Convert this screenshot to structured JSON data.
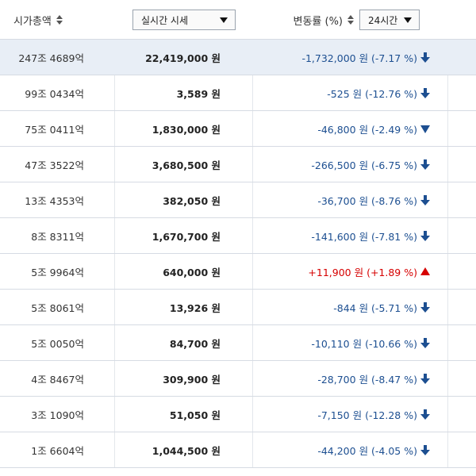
{
  "header": {
    "market_cap_label": "시가총액",
    "realtime_select": "실시간 시세",
    "change_label": "변동률 (%)",
    "period_select": "24시간"
  },
  "colors": {
    "down": "#1d4f91",
    "up": "#d60000",
    "highlight_row": "#e8eef6"
  },
  "rows": [
    {
      "market_cap": "247조 4689억",
      "price": "22,419,000 원",
      "change": "-1,732,000 원 (-7.17 %)",
      "direction": "down",
      "arrow": "arrow-down-bold",
      "highlight": true
    },
    {
      "market_cap": "99조 0434억",
      "price": "3,589 원",
      "change": "-525 원 (-12.76 %)",
      "direction": "down",
      "arrow": "arrow-down-bold",
      "highlight": false
    },
    {
      "market_cap": "75조 0411억",
      "price": "1,830,000 원",
      "change": "-46,800 원 (-2.49 %)",
      "direction": "down",
      "arrow": "triangle-down",
      "highlight": false
    },
    {
      "market_cap": "47조 3522억",
      "price": "3,680,500 원",
      "change": "-266,500 원 (-6.75 %)",
      "direction": "down",
      "arrow": "arrow-down-bold",
      "highlight": false
    },
    {
      "market_cap": "13조 4353억",
      "price": "382,050 원",
      "change": "-36,700 원 (-8.76 %)",
      "direction": "down",
      "arrow": "arrow-down-bold",
      "highlight": false
    },
    {
      "market_cap": "8조 8311억",
      "price": "1,670,700 원",
      "change": "-141,600 원 (-7.81 %)",
      "direction": "down",
      "arrow": "arrow-down-bold",
      "highlight": false
    },
    {
      "market_cap": "5조 9964억",
      "price": "640,000 원",
      "change": "+11,900 원 (+1.89 %)",
      "direction": "up",
      "arrow": "triangle-up",
      "highlight": false
    },
    {
      "market_cap": "5조 8061억",
      "price": "13,926 원",
      "change": "-844 원 (-5.71 %)",
      "direction": "down",
      "arrow": "arrow-down-bold",
      "highlight": false
    },
    {
      "market_cap": "5조 0050억",
      "price": "84,700 원",
      "change": "-10,110 원 (-10.66 %)",
      "direction": "down",
      "arrow": "arrow-down-bold",
      "highlight": false
    },
    {
      "market_cap": "4조 8467억",
      "price": "309,900 원",
      "change": "-28,700 원 (-8.47 %)",
      "direction": "down",
      "arrow": "arrow-down-bold",
      "highlight": false
    },
    {
      "market_cap": "3조 1090억",
      "price": "51,050 원",
      "change": "-7,150 원 (-12.28 %)",
      "direction": "down",
      "arrow": "arrow-down-bold",
      "highlight": false
    },
    {
      "market_cap": "1조 6604억",
      "price": "1,044,500 원",
      "change": "-44,200 원 (-4.05 %)",
      "direction": "down",
      "arrow": "arrow-down-bold",
      "highlight": false
    }
  ]
}
